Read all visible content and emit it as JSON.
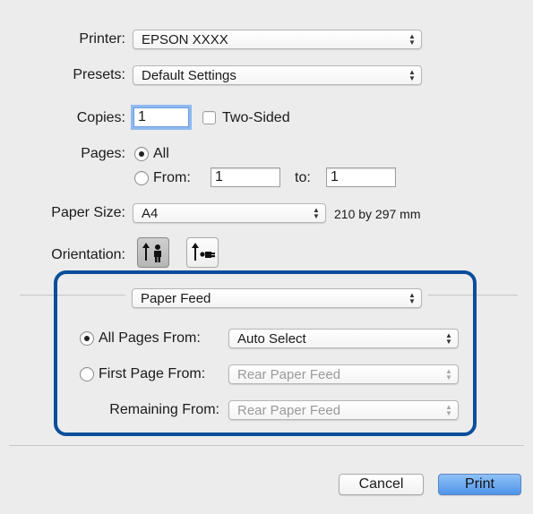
{
  "printer": {
    "label": "Printer:",
    "value": "EPSON XXXX"
  },
  "presets": {
    "label": "Presets:",
    "value": "Default Settings"
  },
  "copies": {
    "label": "Copies:",
    "value": "1",
    "two_sided_label": "Two-Sided"
  },
  "pages": {
    "label": "Pages:",
    "all_label": "All",
    "from_label": "From:",
    "from_value": "1",
    "to_label": "to:",
    "to_value": "1",
    "selected": "All"
  },
  "paper_size": {
    "label": "Paper Size:",
    "value": "A4",
    "dimensions": "210 by 297 mm"
  },
  "orientation": {
    "label": "Orientation:",
    "selected": "portrait"
  },
  "section_menu": {
    "value": "Paper Feed"
  },
  "paper_feed": {
    "all_pages_label": "All Pages From:",
    "all_pages_value": "Auto Select",
    "first_page_label": "First Page From:",
    "first_page_value": "Rear Paper Feed",
    "remaining_label": "Remaining From:",
    "remaining_value": "Rear Paper Feed",
    "selected": "All Pages From"
  },
  "buttons": {
    "cancel": "Cancel",
    "print": "Print"
  },
  "colors": {
    "highlight": "#0a4e9b",
    "default_button": "#5fa0ef",
    "focus_ring": "#8fbaf0"
  }
}
